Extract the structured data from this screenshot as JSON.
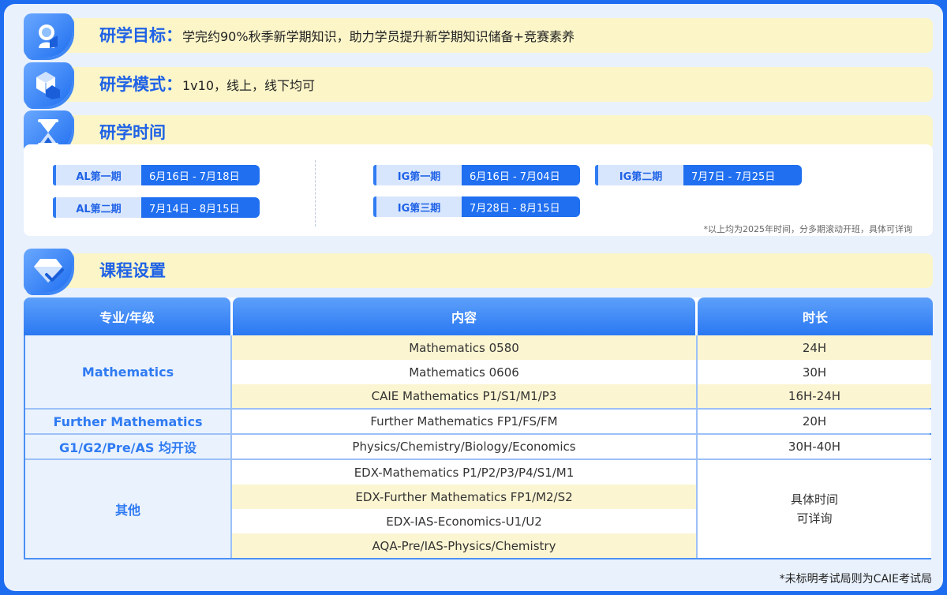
{
  "goal": {
    "label": "研学目标：",
    "text": "学完约90%秋季新学期知识，助力学员提升新学期知识储备+竞赛素养",
    "icon": "student-icon"
  },
  "mode": {
    "label": "研学模式：",
    "text": "1v10，线上，线下均可",
    "icon": "cube-icon"
  },
  "time": {
    "label": "研学时间",
    "icon": "hourglass-icon",
    "periods": [
      {
        "tag": "AL第一期",
        "date": "6月16日 - 7月18日"
      },
      {
        "tag": "AL第二期",
        "date": "7月14日 - 8月15日"
      },
      {
        "tag": "IG第一期",
        "date": "6月16日 - 7月04日"
      },
      {
        "tag": "IG第二期",
        "date": "7月7日 - 7月25日"
      },
      {
        "tag": "IG第三期",
        "date": "7月28日 - 8月15日"
      }
    ],
    "note": "*以上均为2025年时间，分多期滚动开班，具体可详询"
  },
  "course": {
    "label": "课程设置",
    "icon": "diamond-check-icon",
    "headers": [
      "专业/年级",
      "内容",
      "时长"
    ],
    "categories": [
      "Mathematics",
      "Further Mathematics",
      "G1/G2/Pre/AS  均开设",
      "其他"
    ],
    "rows": [
      {
        "content": "Mathematics 0580",
        "duration": "24H"
      },
      {
        "content": "Mathematics 0606",
        "duration": "30H"
      },
      {
        "content": "CAIE Mathematics P1/S1/M1/P3",
        "duration": "16H-24H"
      },
      {
        "content": "Further Mathematics FP1/FS/FM",
        "duration": "20H"
      },
      {
        "content": "Physics/Chemistry/Biology/Economics",
        "duration": "30H-40H"
      },
      {
        "content": "EDX-Mathematics P1/P2/P3/P4/S1/M1"
      },
      {
        "content": "EDX-Further Mathematics FP1/M2/S2"
      },
      {
        "content": "EDX-IAS-Economics-U1/U2"
      },
      {
        "content": "AQA-Pre/IAS-Physics/Chemistry"
      }
    ],
    "other_duration_line1": "具体时间",
    "other_duration_line2": "可详询"
  },
  "footnote": "*未标明考试局则为CAIE考试局"
}
